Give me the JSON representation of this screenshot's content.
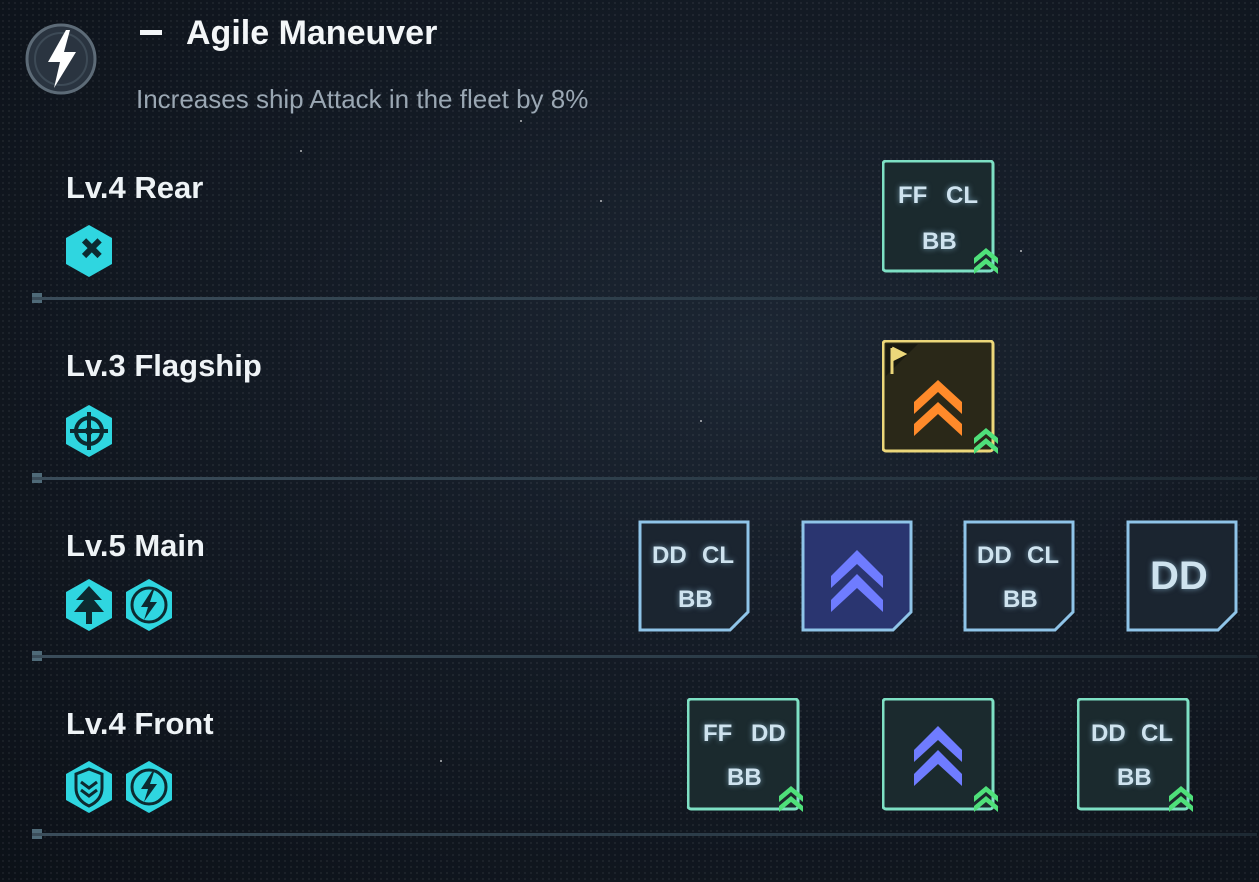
{
  "header": {
    "title": "Agile Maneuver",
    "description": "Increases ship Attack in the fleet by 8%",
    "icon": "lightning-icon"
  },
  "rows": [
    {
      "label": "Lv.4 Rear",
      "icons": [
        "hex-cross-icon"
      ],
      "cards": [
        {
          "kind": "ships",
          "tags": [
            "FF",
            "CL",
            "BB"
          ],
          "frame": "green",
          "upgrade": true
        }
      ]
    },
    {
      "label": "Lv.3 Flagship",
      "icons": [
        "hex-crosshair-icon"
      ],
      "cards": [
        {
          "kind": "chevron",
          "color": "orange",
          "frame": "yellow",
          "flag": true,
          "upgrade": true
        }
      ]
    },
    {
      "label": "Lv.5 Main",
      "icons": [
        "hex-tree-icon",
        "hex-lightning-icon"
      ],
      "cards": [
        {
          "kind": "ships",
          "tags": [
            "DD",
            "CL",
            "BB"
          ],
          "frame": "blue",
          "upgrade": false
        },
        {
          "kind": "chevron",
          "color": "blue",
          "frame": "blue",
          "upgrade": false
        },
        {
          "kind": "ships",
          "tags": [
            "DD",
            "CL",
            "BB"
          ],
          "frame": "blue",
          "upgrade": false
        },
        {
          "kind": "ships",
          "tags": [
            "DD"
          ],
          "frame": "blue",
          "upgrade": false
        }
      ]
    },
    {
      "label": "Lv.4 Front",
      "icons": [
        "hex-shield-icon",
        "hex-lightning-icon"
      ],
      "cards": [
        {
          "kind": "ships",
          "tags": [
            "FF",
            "DD",
            "BB"
          ],
          "frame": "green",
          "upgrade": true
        },
        {
          "kind": "chevron",
          "color": "blue",
          "frame": "green",
          "upgrade": true
        },
        {
          "kind": "ships",
          "tags": [
            "DD",
            "CL",
            "BB"
          ],
          "frame": "green",
          "upgrade": true
        }
      ]
    }
  ],
  "colors": {
    "accent_cyan": "#2fd6e0",
    "frame_green": "#7ee0c4",
    "frame_blue": "#8fc4e8",
    "frame_yellow": "#ecd77a",
    "chevron_orange": "#ff8a2a",
    "chevron_blue": "#6f7cff",
    "upgrade_green": "#4fe07a"
  }
}
